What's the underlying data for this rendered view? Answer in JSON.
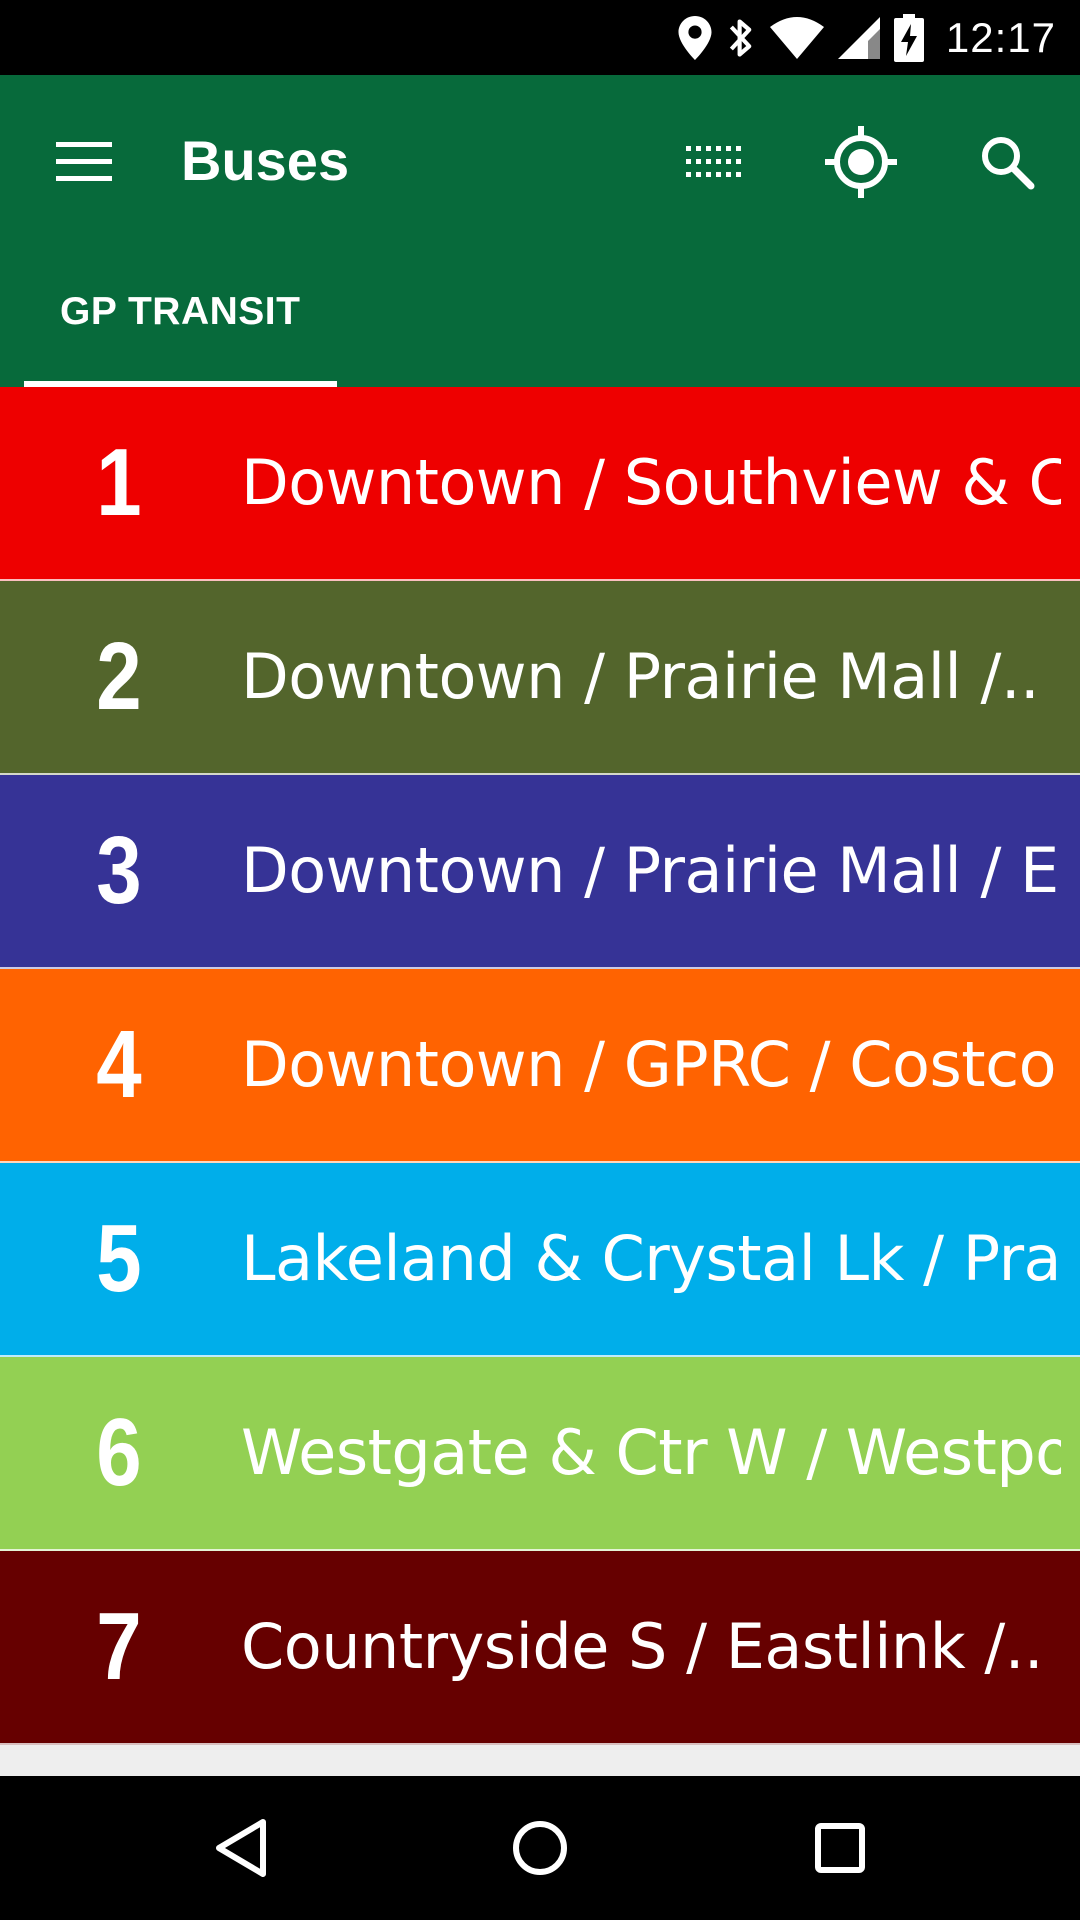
{
  "status_bar": {
    "time": "12:17",
    "icons": [
      "location-pin-icon",
      "bluetooth-icon",
      "wifi-icon",
      "signal-icon",
      "battery-charging-icon"
    ]
  },
  "app_bar": {
    "title": "Buses",
    "actions": [
      "grid-icon",
      "my-location-icon",
      "search-icon"
    ],
    "background": "#076a3b"
  },
  "tabs": [
    {
      "label": "GP TRANSIT",
      "selected": true
    }
  ],
  "routes": [
    {
      "number": "1",
      "name": "Downtown / Southview & C..",
      "color": "#ee0000"
    },
    {
      "number": "2",
      "name": "Downtown / Prairie Mall /..",
      "color": "#53652c"
    },
    {
      "number": "3",
      "name": "Downtown / Prairie Mall / E..",
      "color": "#363396"
    },
    {
      "number": "4",
      "name": "Downtown / GPRC / Costco",
      "color": "#ff6301"
    },
    {
      "number": "5",
      "name": "Lakeland & Crystal Lk / Prai..",
      "color": "#00aeea"
    },
    {
      "number": "6",
      "name": "Westgate & Ctr W / Westpo..",
      "color": "#93d053"
    },
    {
      "number": "7",
      "name": "Countryside S / Eastlink /..",
      "color": "#660000"
    }
  ],
  "nav_bar": {
    "buttons": [
      "back-icon",
      "home-icon",
      "recents-icon"
    ]
  }
}
